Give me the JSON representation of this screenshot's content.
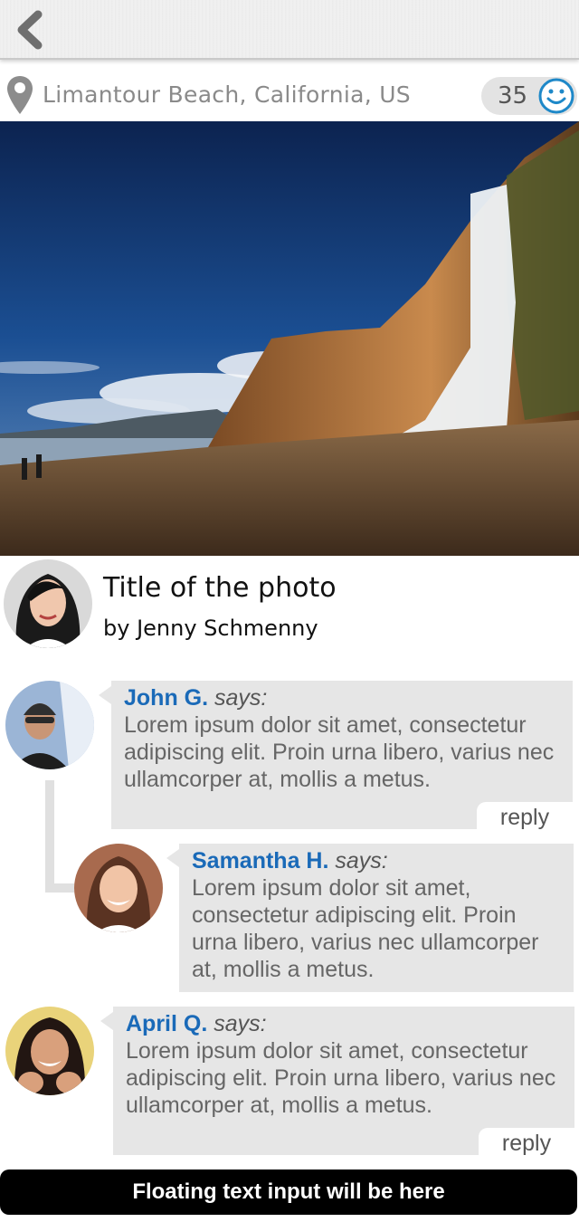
{
  "header": {
    "back_icon": "chevron-left-icon"
  },
  "location": {
    "icon": "map-pin-icon",
    "text": "Limantour Beach, California, US",
    "like_count": "35",
    "like_icon": "smiley-icon",
    "accent_color": "#1e88c8"
  },
  "photo": {
    "title": "Title of the photo",
    "byline": "by Jenny Schmenny"
  },
  "comments": [
    {
      "name": "John G.",
      "says": "says:",
      "text": "Lorem ipsum dolor sit amet, consectetur adipiscing elit. Proin urna libero, varius nec ullamcorper at, mollis a metus.",
      "reply_label": "reply"
    },
    {
      "name": "Samantha H.",
      "says": "says:",
      "text": "Lorem ipsum dolor sit amet, consectetur adipiscing elit. Proin urna libero, varius nec ullamcorper at, mollis a metus."
    },
    {
      "name": "April Q.",
      "says": "says:",
      "text": "Lorem ipsum dolor sit amet, consectetur adipiscing elit. Proin urna libero, varius nec ullamcorper at, mollis a metus.",
      "reply_label": "reply"
    }
  ],
  "input_bar": {
    "label": "Floating text input will be here"
  },
  "colors": {
    "name_blue": "#1a6ab8",
    "bubble_gray": "#e6e6e6"
  }
}
